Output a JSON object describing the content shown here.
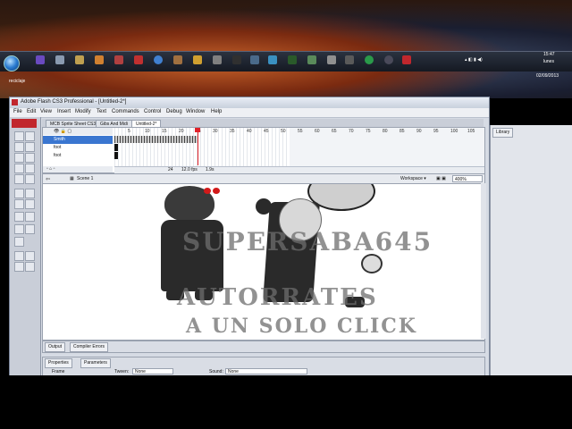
{
  "desktop": {
    "recycle_label": "reciclaje",
    "clock_time": "15:47",
    "clock_day": "lunes",
    "clock_date": "02/09/2013"
  },
  "window": {
    "title": "Adobe Flash CS3 Professional - [Untitled-2*]"
  },
  "menu": [
    "File",
    "Edit",
    "View",
    "Insert",
    "Modify",
    "Text",
    "Commands",
    "Control",
    "Debug",
    "Window",
    "Help"
  ],
  "doc_tabs": [
    "MCB Sprite Sheet CS3",
    "Gibs And Midi",
    "Untitled-2*"
  ],
  "timeline": {
    "layers": [
      "Smith",
      "foot",
      "foot"
    ],
    "ruler": [
      "5",
      "10",
      "15",
      "20",
      "25",
      "30",
      "35",
      "40",
      "45",
      "50",
      "55",
      "60",
      "65",
      "70",
      "75",
      "80",
      "85",
      "90",
      "95",
      "100",
      "105"
    ],
    "status_frame": "24",
    "status_fps": "12.0 fps",
    "status_time": "1.9s"
  },
  "editbar": {
    "scene": "Scene 1",
    "workspace": "Workspace ▾",
    "zoom": "400%"
  },
  "stage": {
    "watermark1": "SUPERSABA645",
    "watermark2": "AUTORRATES",
    "watermark3": "A UN SOLO CLICK"
  },
  "panels": {
    "output_tab": "Output",
    "compiler_tab": "Compiler Errors",
    "properties_tab": "Properties",
    "parameters_tab": "Parameters",
    "tween_label": "Tween:",
    "tween_value": "None",
    "sound_label": "Sound:",
    "sound_value": "None",
    "frame_label": "Frame"
  },
  "library": {
    "tab": "Library"
  },
  "colors": {
    "playhead": "#e0222a",
    "flash_logo": "#c1272d"
  }
}
